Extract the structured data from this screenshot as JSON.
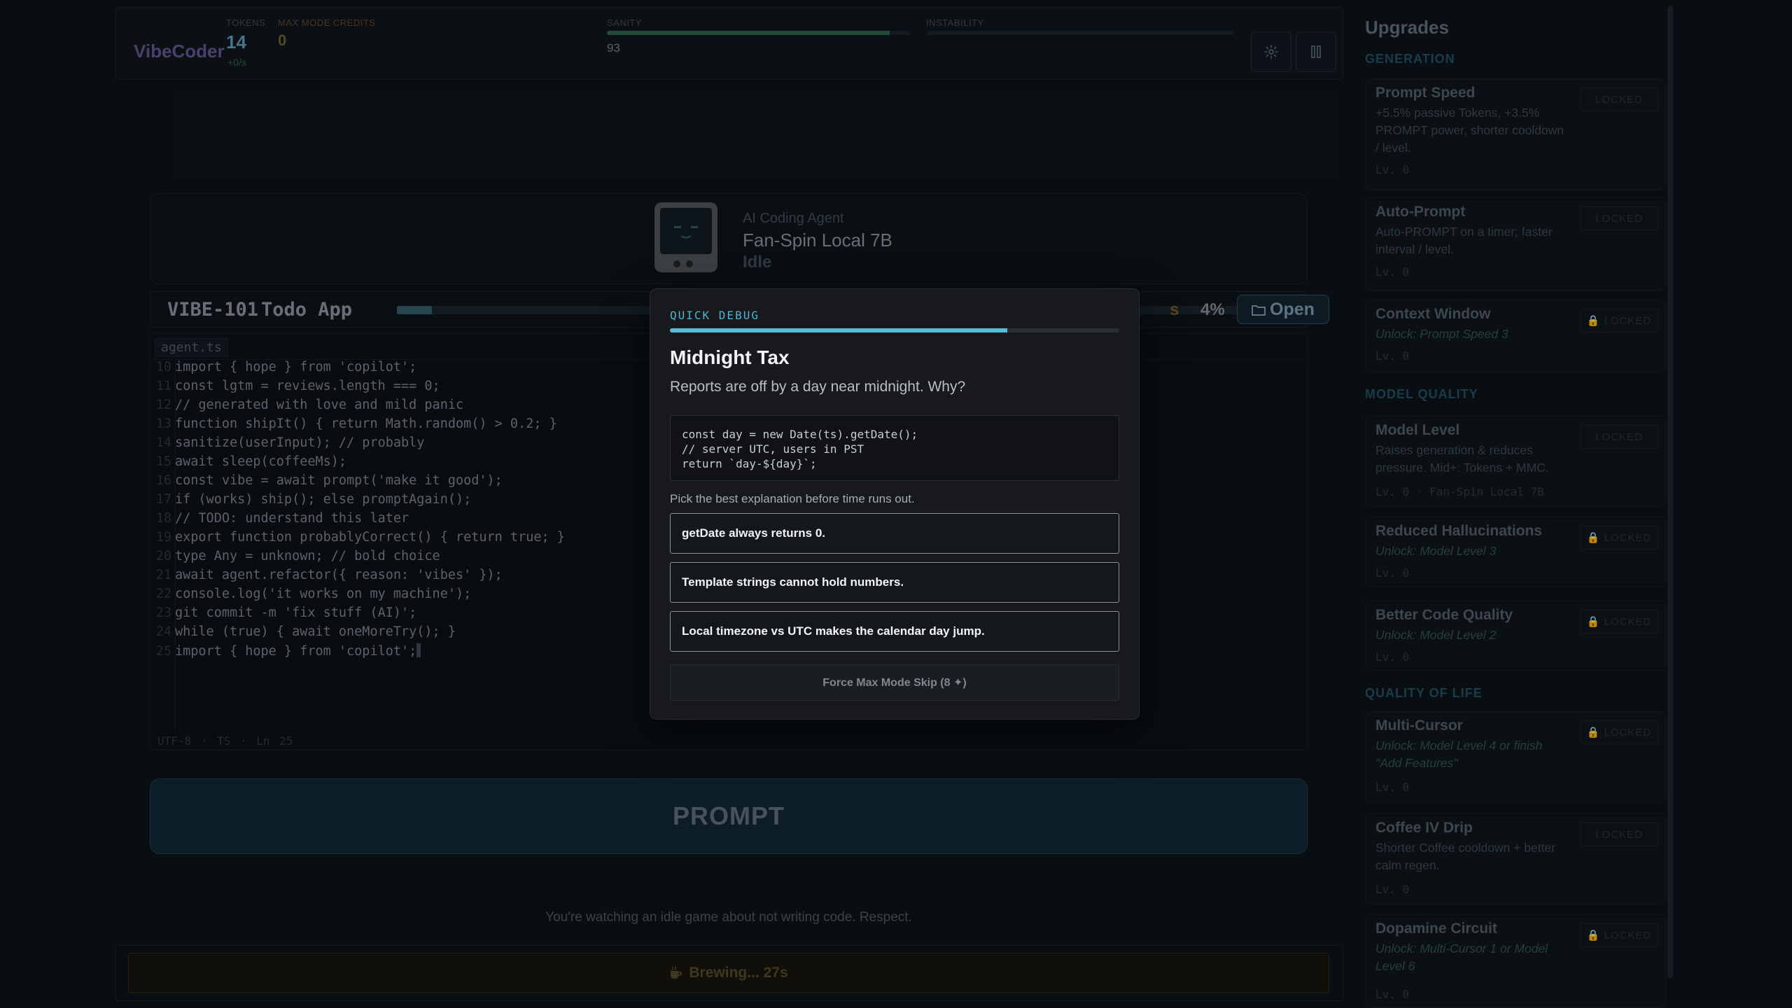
{
  "app": {
    "brand": "VibeCoder",
    "stats": {
      "tokens_label": "TOKENS",
      "tokens_value": "14",
      "tokens_rate": "+0/s",
      "credits_label": "MAX MODE CREDITS",
      "credits_value": "0",
      "sanity_label": "SANITY",
      "sanity_value": "93",
      "sanity_level": 0.93,
      "instability_label": "INSTABILITY",
      "instability_level": 0
    },
    "toolbar": {
      "settings_icon": "gear-icon",
      "pause_icon": "pause-icon"
    }
  },
  "agent": {
    "subtitle": "AI Coding Agent",
    "name": "Fan-Spin Local 7B",
    "status": "Idle",
    "avatar_icon": "robot-monitor-icon"
  },
  "ticket": {
    "id": "VIBE-101",
    "name": "Todo App",
    "progress": 0.04,
    "status_tail": "s",
    "percent": "4%",
    "open_label": "Open",
    "open_icon": "folder-icon"
  },
  "editor": {
    "file_tab": "agent.ts",
    "lines": [
      {
        "n": "10",
        "t": "import { hope } from 'copilot';"
      },
      {
        "n": "11",
        "t": "const lgtm = reviews.length === 0;"
      },
      {
        "n": "12",
        "t": "// generated with love and mild panic"
      },
      {
        "n": "13",
        "t": "function shipIt() { return Math.random() > 0.2; }"
      },
      {
        "n": "14",
        "t": "sanitize(userInput); // probably"
      },
      {
        "n": "15",
        "t": "await sleep(coffeeMs);"
      },
      {
        "n": "16",
        "t": "const vibe = await prompt('make it good');"
      },
      {
        "n": "17",
        "t": "if (works) ship(); else promptAgain();"
      },
      {
        "n": "18",
        "t": "// TODO: understand this later"
      },
      {
        "n": "19",
        "t": "export function probablyCorrect() { return true; }"
      },
      {
        "n": "20",
        "t": "type Any = unknown; // bold choice"
      },
      {
        "n": "21",
        "t": "await agent.refactor({ reason: 'vibes' });"
      },
      {
        "n": "22",
        "t": "console.log('it works on my machine');"
      },
      {
        "n": "23",
        "t": "git commit -m 'fix stuff (AI)';"
      },
      {
        "n": "24",
        "t": "while (true) { await oneMoreTry(); }"
      },
      {
        "n": "25",
        "t": "import { hope } from 'copilot';"
      }
    ],
    "status_bar": "UTF-8 · TS · Ln 25"
  },
  "prompt": {
    "label": "PROMPT"
  },
  "tagline": "You're watching an idle game about not writing code. Respect.",
  "brew": {
    "label": "Brewing... 27s",
    "icon": "coffee-icon"
  },
  "sidebar": {
    "title": "Upgrades",
    "categories": [
      {
        "label": "GENERATION"
      },
      {
        "label": "MODEL QUALITY"
      },
      {
        "label": "QUALITY OF LIFE"
      }
    ],
    "upgrades": [
      {
        "name": "Prompt Speed",
        "desc": "+5.5% passive Tokens, +3.5% PROMPT power, shorter cooldown / level.",
        "level": "Lv. 0",
        "badge": "LOCKED"
      },
      {
        "name": "Auto-Prompt",
        "desc": "Auto-PROMPT on a timer; faster interval / level.",
        "level": "Lv. 0",
        "badge": "LOCKED"
      },
      {
        "name": "Context Window",
        "desc": "Unlock: Prompt Speed 3",
        "level": "Lv. 0",
        "badge": "🔒 LOCKED"
      },
      {
        "name": "Model Level",
        "desc": "Raises generation & reduces pressure. Mid+: Tokens + MMC.",
        "level": "Lv. 0 · Fan-Spin Local 7B",
        "badge": "LOCKED"
      },
      {
        "name": "Reduced Hallucinations",
        "desc": "Unlock: Model Level 3",
        "level": "Lv. 0",
        "badge": "🔒 LOCKED"
      },
      {
        "name": "Better Code Quality",
        "desc": "Unlock: Model Level 2",
        "level": "Lv. 0",
        "badge": "🔒 LOCKED"
      },
      {
        "name": "Multi-Cursor",
        "desc": "Unlock: Model Level 4 or finish \"Add Features\"",
        "level": "Lv. 0",
        "badge": "🔒 LOCKED"
      },
      {
        "name": "Coffee IV Drip",
        "desc": "Shorter Coffee cooldown + better calm regen.",
        "level": "Lv. 0",
        "badge": "LOCKED"
      },
      {
        "name": "Dopamine Circuit",
        "desc": "Unlock: Multi-Cursor 1 or Model Level 6",
        "level": "Lv. 0",
        "badge": "🔒 LOCKED"
      }
    ]
  },
  "modal": {
    "eyebrow": "QUICK DEBUG",
    "timer_remaining": 0.75,
    "title": "Midnight Tax",
    "description": "Reports are off by a day near midnight. Why?",
    "code": "const day = new Date(ts).getDate();\n// server UTC, users in PST\nreturn `day-${day}`;",
    "hint": "Pick the best explanation before time runs out.",
    "options": [
      "getDate always returns 0.",
      "Template strings cannot hold numbers.",
      "Local timezone vs UTC makes the calendar day jump."
    ],
    "skip_label": "Force Max Mode Skip (8 ✦)"
  }
}
